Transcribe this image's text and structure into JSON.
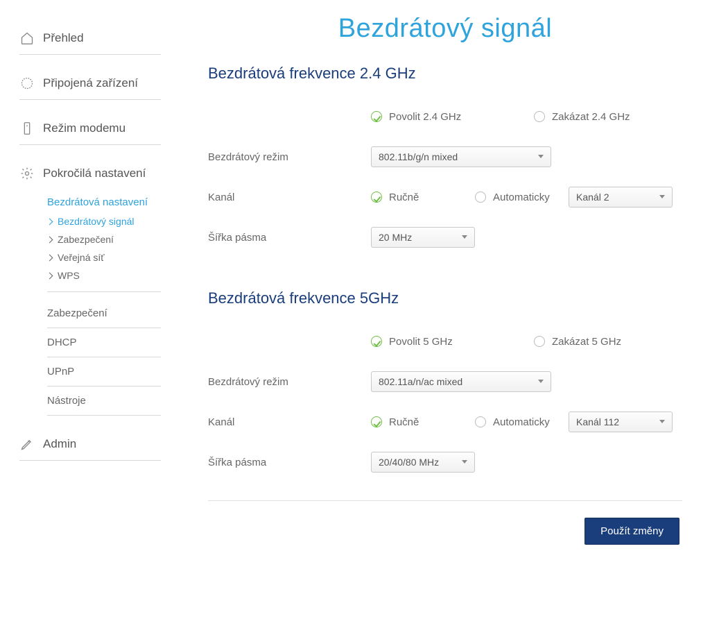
{
  "sidebar": {
    "overview": "Přehled",
    "devices": "Připojená zařízení",
    "modem_mode": "Režim modemu",
    "advanced": "Pokročilá nastavení",
    "admin": "Admin",
    "wireless_header": "Bezdrátová nastavení",
    "wireless_items": {
      "signal": "Bezdrátový signál",
      "security": "Zabezpečení",
      "public_net": "Veřejná síť",
      "wps": "WPS"
    },
    "plain_items": {
      "security": "Zabezpečení",
      "dhcp": "DHCP",
      "upnp": "UPnP",
      "tools": "Nástroje"
    }
  },
  "page": {
    "title": "Bezdrátový signál"
  },
  "freq24": {
    "title": "Bezdrátová frekvence 2.4 GHz",
    "enable": "Povolit 2.4 GHz",
    "disable": "Zakázat 2.4 GHz",
    "mode_label": "Bezdrátový režim",
    "mode_value": "802.11b/g/n mixed",
    "channel_label": "Kanál",
    "manual": "Ručně",
    "auto": "Automaticky",
    "channel_value": "Kanál 2",
    "bandwidth_label": "Šířka pásma",
    "bandwidth_value": "20 MHz"
  },
  "freq5": {
    "title": "Bezdrátová frekvence 5GHz",
    "enable": "Povolit 5 GHz",
    "disable": "Zakázat 5 GHz",
    "mode_label": "Bezdrátový režim",
    "mode_value": "802.11a/n/ac mixed",
    "channel_label": "Kanál",
    "manual": "Ručně",
    "auto": "Automaticky",
    "channel_value": "Kanál 112",
    "bandwidth_label": "Šířka pásma",
    "bandwidth_value": "20/40/80 MHz"
  },
  "actions": {
    "apply": "Použít změny"
  }
}
